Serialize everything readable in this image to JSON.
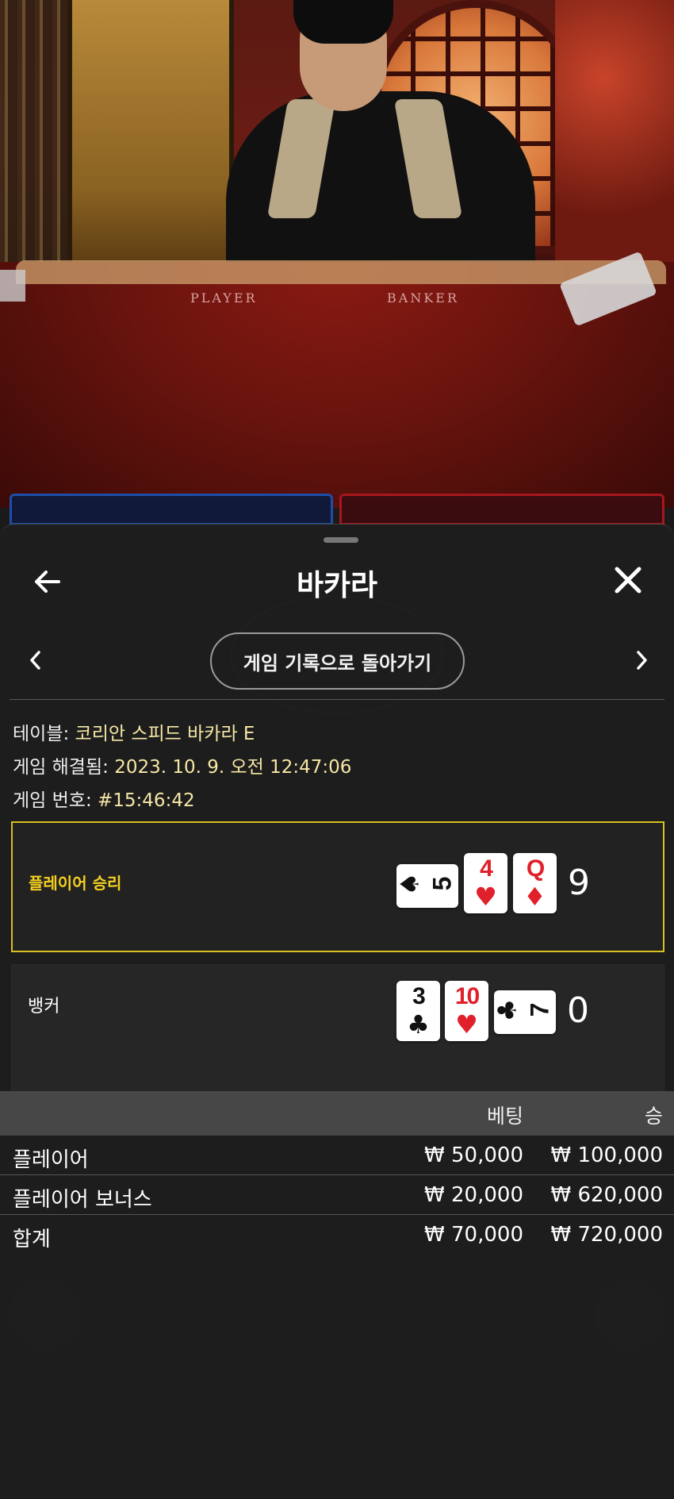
{
  "video": {
    "felt_left": "PLAYER",
    "felt_right": "BANKER"
  },
  "sheet": {
    "title": "바카라",
    "back_to_history": "게임 기록으로 돌아가기",
    "info": {
      "table_label": "테이블:",
      "table_value": "코리안 스피드 바카라 E",
      "resolved_label": "게임 해결됨:",
      "resolved_value": "2023. 10. 9. 오전 12:47:06",
      "number_label": "게임 번호:",
      "number_value": "#15:46:42"
    },
    "results": [
      {
        "label": "플레이어 승리",
        "score": "9",
        "winner": true,
        "cards": [
          {
            "rank": "5",
            "suit": "♠",
            "color": "#111111",
            "orientation": "sideways"
          },
          {
            "rank": "4",
            "suit": "♥",
            "color": "#e0202a",
            "orientation": "upright"
          },
          {
            "rank": "Q",
            "suit": "♦",
            "color": "#e0202a",
            "orientation": "upright"
          }
        ]
      },
      {
        "label": "뱅커",
        "score": "0",
        "winner": false,
        "cards": [
          {
            "rank": "3",
            "suit": "♣",
            "color": "#111111",
            "orientation": "upright"
          },
          {
            "rank": "10",
            "suit": "♥",
            "color": "#e0202a",
            "orientation": "upright"
          },
          {
            "rank": "7",
            "suit": "♣",
            "color": "#111111",
            "orientation": "sideways"
          }
        ]
      }
    ],
    "table": {
      "headers": [
        "",
        "베팅",
        "승"
      ],
      "rows": [
        [
          "플레이어",
          "₩ 50,000",
          "₩ 100,000"
        ],
        [
          "플레이어 보너스",
          "₩ 20,000",
          "₩ 620,000"
        ]
      ],
      "total": [
        "합계",
        "₩ 70,000",
        "₩ 720,000"
      ]
    }
  },
  "colors": {
    "win_border": "#d8c020",
    "win_label": "#f5d020",
    "info_value": "#f6e7a6",
    "player_blue": "#1e4ea8",
    "banker_red": "#a8161e"
  }
}
